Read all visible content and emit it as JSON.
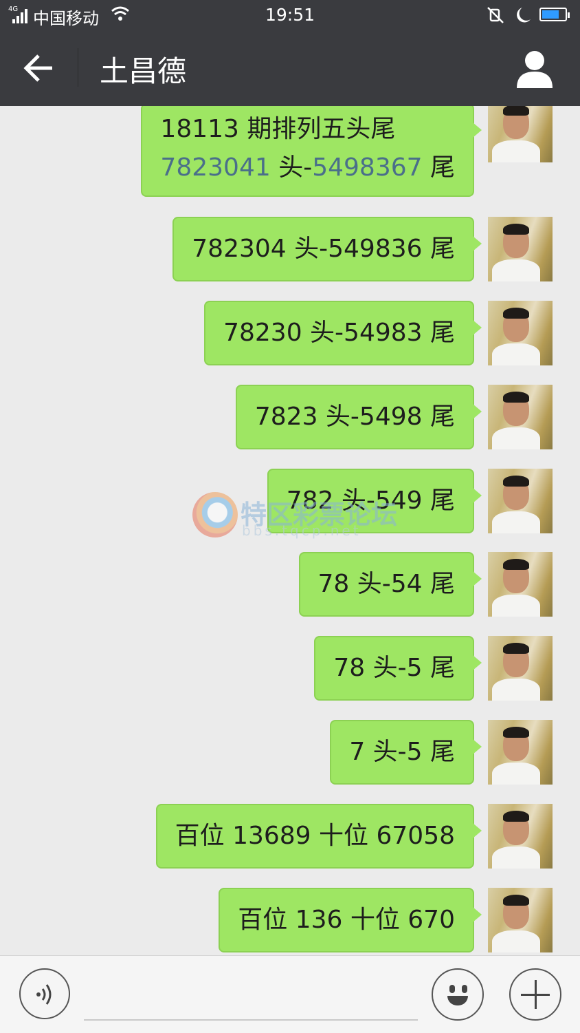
{
  "status_bar": {
    "network": "4G",
    "carrier": "中国移动",
    "time": "19:51"
  },
  "header": {
    "title": "土昌德"
  },
  "messages": [
    {
      "line1": "18113 期排列五头尾",
      "line2_a": "7823041",
      "line2_b": " 头-",
      "line2_c": "5498367",
      "line2_d": " 尾"
    },
    {
      "text": "782304 头-549836 尾"
    },
    {
      "text": "78230 头-54983 尾"
    },
    {
      "text": "7823 头-5498 尾"
    },
    {
      "text": "782 头-549 尾"
    },
    {
      "text": "78 头-54 尾"
    },
    {
      "text": "78 头-5 尾"
    },
    {
      "text": "7 头-5 尾"
    },
    {
      "text": "百位 13689 十位 67058"
    },
    {
      "text": "百位 136 十位 670"
    }
  ],
  "watermark": {
    "name": "特区彩票论坛",
    "url": "bbs.tqcp.net"
  },
  "input_bar": {
    "voice_icon": "voice-icon",
    "emoji_icon": "emoji-icon",
    "plus_icon": "plus-icon"
  }
}
